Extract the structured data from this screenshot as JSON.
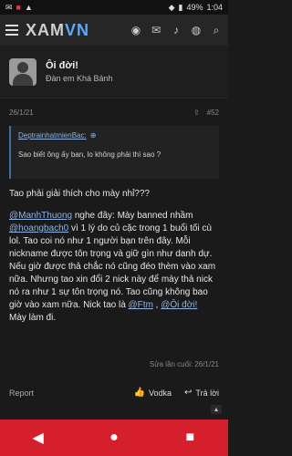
{
  "status_bar": {
    "battery": "49%",
    "time": "1:04"
  },
  "app": {
    "logo_main": "XAM",
    "logo_accent": "VN",
    "nav_icons": [
      "hamburger-icon",
      "bell-icon",
      "chat-icon",
      "user-icon",
      "search-icon"
    ]
  },
  "profile": {
    "username": "Ôi đời!",
    "user_title": "Đàn em Khá Bảnh"
  },
  "post_meta": {
    "date": "26/1/21",
    "share_icon": "share-icon",
    "post_number": "#52"
  },
  "quote": {
    "author": "DeptrainhatmienBac:",
    "text": "Sao biết ông ấy ban, lo không phải thì sao ?"
  },
  "post": {
    "line1": "Tao phải giải thích cho mày nhỉ???",
    "mention1": "@ManhThuong",
    "text1": " nghe đây: Mày banned nhầm ",
    "mention2": "@hoangbach0",
    "text2": " vì 1 lý do củ cặc trong 1 buổi tối cù lol. Tao coi nó như 1 người bạn trên đây. Mỗi nickname được tôn trọng và giữ gìn như danh dự. Nếu giờ được thả chắc nó cũng đéo thèm vào xam nữa. Nhưng tao xin đổi 2 nick này để mày thả nick nó ra như 1 sự tôn trọng nó. Tao cũng không bao giờ vào xam nữa. Nick tao là ",
    "mention3": "@Ftm",
    "text3": " , ",
    "mention4": "@Ôi đời!",
    "line_last": "Mày làm đi."
  },
  "edited": "Sửa lần cuối: 26/1/21",
  "footer": {
    "report": "Report",
    "vote_label": "Vodka",
    "reply_label": "Trả lời"
  },
  "colors": {
    "accent": "#5aa9ff",
    "bottom_bar": "#d61f2c",
    "link": "#8fb4e0"
  }
}
